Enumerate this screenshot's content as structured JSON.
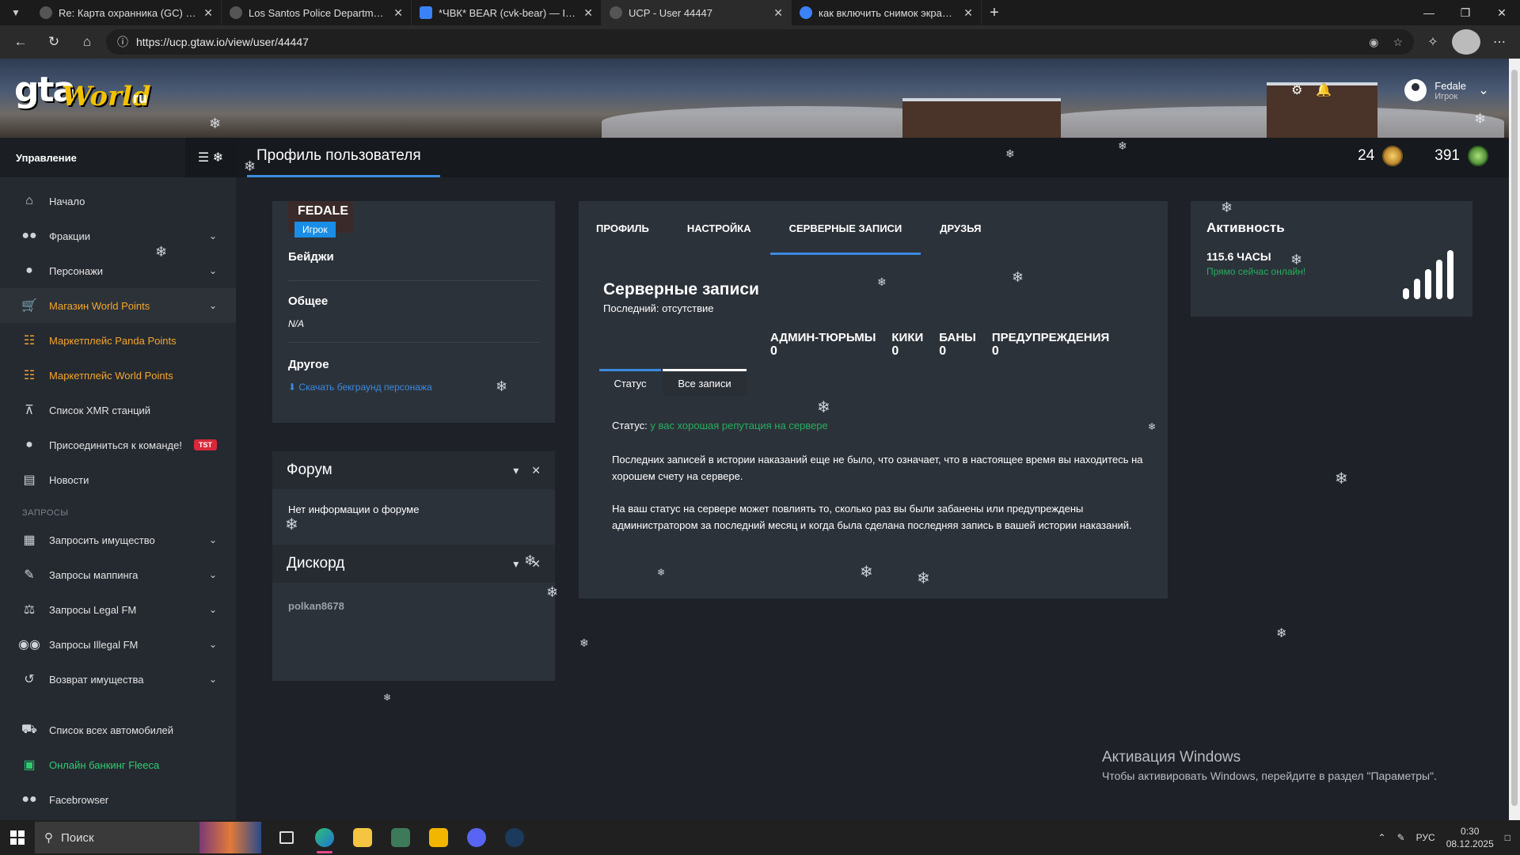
{
  "browser": {
    "tabs": [
      {
        "title": "Re: Карта охранника (GC) - Los S",
        "active": false
      },
      {
        "title": "Los Santos Police Department - H",
        "active": false
      },
      {
        "title": "*ЧВК* BEAR (cvk-bear) — ImgBB",
        "active": false
      },
      {
        "title": "UCP - User 44447",
        "active": true
      },
      {
        "title": "как включить снимок экрана - П",
        "active": false
      }
    ],
    "url": "https://ucp.gtaw.io/view/user/44447"
  },
  "logo": {
    "gta": "gta",
    "world": "World",
    "ru": "ru"
  },
  "user": {
    "name": "Fedale",
    "role": "Игрок"
  },
  "sidebar": {
    "title": "Управление",
    "items": [
      {
        "label": "Начало",
        "icon": "home-icon"
      },
      {
        "label": "Фракции",
        "icon": "users-icon",
        "chevron": true
      },
      {
        "label": "Персонажи",
        "icon": "user-icon",
        "chevron": true
      },
      {
        "label": "Магазин World Points",
        "icon": "cart-icon",
        "chevron": true
      },
      {
        "label": "Маркетплейс Panda Points",
        "icon": "coins-icon"
      },
      {
        "label": "Маркетплейс World Points",
        "icon": "coins-icon"
      },
      {
        "label": "Список XMR станций",
        "icon": "antenna-icon"
      },
      {
        "label": "Присоединиться к команде!",
        "icon": "user-add-icon",
        "badge": "TST"
      },
      {
        "label": "Новости",
        "icon": "newspaper-icon"
      }
    ],
    "section_requests": "ЗАПРОСЫ",
    "requests": [
      {
        "label": "Запросить имущество",
        "icon": "building-icon"
      },
      {
        "label": "Запросы маппинга",
        "icon": "brush-icon"
      },
      {
        "label": "Запросы Legal FM",
        "icon": "scales-icon"
      },
      {
        "label": "Запросы Illegal FM",
        "icon": "mask-icon"
      },
      {
        "label": "Возврат имущества",
        "icon": "undo-icon"
      }
    ],
    "bottom": [
      {
        "label": "Список всех автомобилей",
        "icon": "car-icon"
      },
      {
        "label": "Онлайн банкинг Fleeca",
        "icon": "money-icon"
      },
      {
        "label": "Facebrowser",
        "icon": "users-icon"
      }
    ]
  },
  "header": {
    "title": "Профиль пользователя",
    "stat1": "24",
    "stat2": "391"
  },
  "profile": {
    "name": "FEDALE",
    "role": "Игрок",
    "badges_title": "Бейджи",
    "general_title": "Общее",
    "general_value": "N/A",
    "other_title": "Другое",
    "download_link": "Скачать бекграунд персонажа"
  },
  "forum": {
    "title": "Форум",
    "text": "Нет информации о форуме"
  },
  "discord": {
    "title": "Дискорд",
    "username": "polkan8678"
  },
  "records": {
    "tabs": [
      "ПРОФИЛЬ",
      "НАСТРОЙКА",
      "СЕРВЕРНЫЕ ЗАПИСИ",
      "ДРУЗЬЯ"
    ],
    "title": "Серверные записи",
    "last": "Последний: отсутствие",
    "counters": [
      {
        "label": "АДМИН-ТЮРЬМЫ",
        "value": "0"
      },
      {
        "label": "КИКИ",
        "value": "0"
      },
      {
        "label": "БАНЫ",
        "value": "0"
      },
      {
        "label": "ПРЕДУПРЕЖДЕНИЯ",
        "value": "0"
      }
    ],
    "subtab_status": "Статус",
    "subtab_all": "Все записи",
    "status_label": "Статус:",
    "status_value": "у вас хорошая репутация на сервере",
    "para1": "Последних записей в истории наказаний еще не было, что означает, что в настоящее время вы находитесь на хорошем счету на сервере.",
    "para2": "На ваш статус на сервере может повлиять то, сколько раз вы были забанены или предупреждены администратором за последний месяц и когда была сделана последняя запись в вашей истории наказаний."
  },
  "activity": {
    "title": "Активность",
    "hours": "115.6 ЧАСЫ",
    "online": "Прямо сейчас онлайн!"
  },
  "activation": {
    "line1": "Активация Windows",
    "line2": "Чтобы активировать Windows, перейдите в раздел \"Параметры\"."
  },
  "taskbar": {
    "search": "Поиск",
    "lang": "РУС",
    "time": "0:30",
    "date": "08.12.2025"
  }
}
